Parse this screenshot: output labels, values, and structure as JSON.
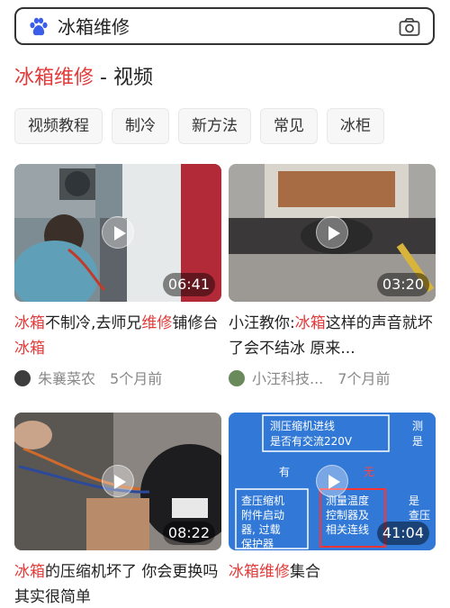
{
  "search": {
    "query": "冰箱维修"
  },
  "section": {
    "title_highlight": "冰箱维修",
    "title_rest": " - 视频"
  },
  "chips": [
    "视频教程",
    "制冷",
    "新方法",
    "常见",
    "冰柜"
  ],
  "videos": [
    {
      "duration": "06:41",
      "title_parts": [
        {
          "text": "冰箱",
          "hl": true
        },
        {
          "text": "不制冷,去师兄",
          "hl": false
        },
        {
          "text": "维修",
          "hl": true
        },
        {
          "text": "铺修台",
          "hl": false
        },
        {
          "text": "冰箱",
          "hl": true
        }
      ],
      "author": "朱襄菜农",
      "time": "5个月前"
    },
    {
      "duration": "03:20",
      "title_parts": [
        {
          "text": "小汪教你:",
          "hl": false
        },
        {
          "text": "冰箱",
          "hl": true
        },
        {
          "text": "这样的声音就坏了会不结冰 原来...",
          "hl": false
        }
      ],
      "author": "小汪科技...",
      "time": "7个月前"
    },
    {
      "duration": "08:22",
      "title_parts": [
        {
          "text": "冰箱",
          "hl": true
        },
        {
          "text": "的压缩机坏了 你会更换吗 其实很简单",
          "hl": false
        }
      ]
    },
    {
      "duration": "41:04",
      "title_parts": [
        {
          "text": "冰箱维修",
          "hl": true
        },
        {
          "text": "集合",
          "hl": false
        }
      ],
      "thumb_text": [
        "测压缩机进线",
        "是否有交流220V",
        "有",
        "无",
        "查压缩机",
        "附件启动",
        "器, 过载",
        "保护器",
        "测量温度",
        "控制器及",
        "相关连线",
        "测",
        "是",
        "是",
        "查压"
      ]
    }
  ],
  "colors": {
    "accent": "#e33a3a"
  }
}
